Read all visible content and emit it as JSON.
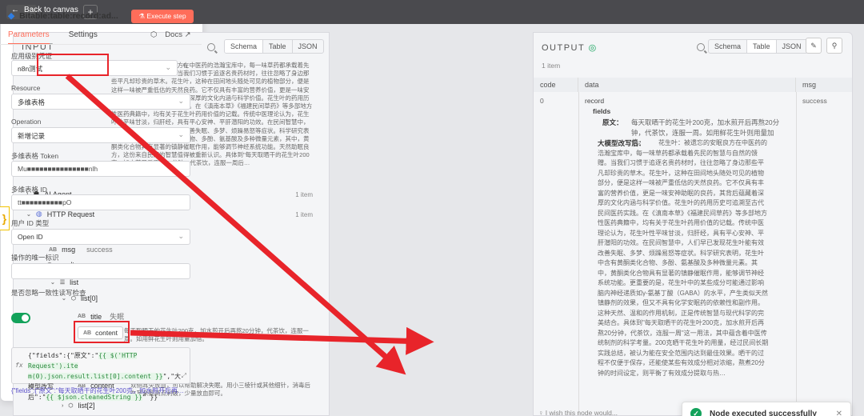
{
  "topbar": {
    "back_label": "Back to canvas"
  },
  "input": {
    "title": "INPUT",
    "view_modes": [
      "Schema",
      "Table",
      "JSON"
    ],
    "cleanedString": {
      "key": "cleanedString",
      "value": "花生叶：被遗忘的安眠良方在中医药的浩瀚宝库中，每一味草药都承载着先民的智慧与自然的馈赠。当我们习惯于追逐名贵药材时，往往忽略了身边那些平凡却珍贵的草木。花生叶，这种在田间地头随处可见的植物部分，便是这样一味被严重低估的天然良药。它不仅具有丰富的营养价值，更是一味安神助眠的良药，其背后蕴藏着深厚的文化内涵与科学价值。花生叶的药用历史可追溯至古代民间医药实践。在《滇南本草》《福建民间草药》等多部地方性医药典籍中，均有关于花生叶药用价值的记载。传统中医理论认为，花生叶性平味甘淡，归肝经，具有平心安神、平肝潜阳的功效。在民间智慧中，人们早已发现花生叶能有效改善失眠、多梦、烦躁易怒等症状。科学研究表明，花生叶中含有黄酮类化合物、多酚、氨基酸及多种微量元素，其中，黄酮类化合物具有显著的镇静催眠作用，能够调节神经系统功能。天然助眠良方，这份来自民间的智慧值得被重新认识。具体到\"每天取晒干的花生叶200克，加水煎开后再熬20分钟，代茶饮，连服一周后…"
    },
    "ai_agent": {
      "label": "AI Agent",
      "count": "1 item"
    },
    "http": {
      "label": "HTTP Request",
      "count": "1 item"
    },
    "code": {
      "key": "code",
      "value": "200"
    },
    "msg": {
      "key": "msg",
      "value": "success"
    },
    "result_key": "result",
    "list_key": "list",
    "list0": {
      "key": "list[0]",
      "title_key": "title",
      "title_val": "失眠",
      "content_key": "content",
      "content_val": "每天取晒干的花生叶200克，加水煎开后再熬20分钟，代茶饮，连服一周。如用鲜花生叶则用量加倍。"
    },
    "list1": {
      "key": "list[1]",
      "title_key": "title",
      "title_val": "失眠",
      "content_key": "content",
      "content_val": "双侧耳尖放血，可以帮助解决失眠。用小三棱针或其他细针，消毒后在耳朵最高点刺破，少量放血即可。"
    },
    "list2": {
      "key": "list[2]"
    }
  },
  "param": {
    "title": "Bitable:table:record:ad...",
    "execute_label": "Execute step",
    "tabs": [
      "Parameters",
      "Settings"
    ],
    "docs_label": "Docs",
    "credential_label": "应用级别凭证",
    "credential_value": "n8n测试",
    "resource_label": "Resource",
    "resource_value": "多维表格",
    "operation_label": "Operation",
    "operation_value": "新增记录",
    "token_label": "多维表格 Token",
    "token_value": "Mu■■■■■■■■■■■■■■■nlh",
    "table_id_label": "多维表格 ID",
    "table_id_value": "tt■■■■■■■■■■pO",
    "user_id_label": "用户 ID 类型",
    "user_id_value": "Open ID",
    "op_id_label": "操作的唯一标识",
    "ignore_label": "是否忽略一致性读写检查",
    "code_line1a": "{\"fields\":{\"原文\":\"",
    "code_line1b": "{{ $('HTTP Request').ite",
    "code_line2": "m(0).json.result.list[0].content }}",
    "code_line2b": "\",\"大模型改写",
    "code_line3a": "后\":\"",
    "code_line3b": "{{ $json.cleanedString }}",
    "code_line3c": "\" }}",
    "result_preview": "{\"fields\":{\"原文\":\"每天取晒干的花生叶200克，加水煎开后再…"
  },
  "output": {
    "title": "OUTPUT",
    "view_modes": [
      "Schema",
      "Table",
      "JSON"
    ],
    "items": "1 item",
    "columns": [
      "code",
      "data",
      "msg"
    ],
    "code_val": "0",
    "record_key": "record",
    "fields_key": "fields",
    "yuanwen_key": "原文：",
    "yuanwen_val": "每天取晒干的花生叶200克，加水煎开后再熬20分钟，代茶饮，连服一周。如用鲜花生叶则用量加倍。",
    "rewrite_key": "大模型改写后：",
    "rewrite_val": "花生叶：被遗忘的安眠良方在中医药的浩瀚宝库中，每一味草药都承载着先民的智慧与自然的馈赠。当我们习惯于追逐名贵药材时，往往忽略了身边那些平凡却珍贵的草木。花生叶，这种在田间地头随处可见的植物部分，便是这样一味被严重低估的天然良药。它不仅具有丰富的营养价值，更是一味安神助眠的良药，其背后蕴藏着深厚的文化内涵与科学价值。花生叶的药用历史可追溯至古代民间医药实践。在《滇南本草》《福建民间草药》等多部地方性医药典籍中，均有关于花生叶药用价值的记载。传统中医理论认为，花生叶性平味甘淡，归肝经，具有平心安神、平肝潜阳的功效。在民间智慧中，人们早已发现花生叶能有效改善失眠、多梦、烦躁易怒等症状。科学研究表明，花生叶中含有黄酮类化合物、多酚、氨基酸及多种微量元素。其中，黄酮类化合物具有显著的镇静催眠作用，能够调节神经系统功能。更重要的是，花生叶中的某些成分可能通过影响脑内神经递质如γ-氨基丁酸（GABA）的水平，产生类似天然镇静剂的效果，但又不具有化学安眠药的依赖性和副作用。这种天然、温和的作用机制，正是传统智慧与现代科学的完美结合。具体到\"每天取晒干的花生叶200克，加水煎开后再熬20分钟，代茶饮，连服一周\"这一用法，其中蕴含着中医传统制剂的科学考量。200克晒干花生叶的用量，经过民间长期实践总结，被认为能在安全范围内达到最佳效果。晒干的过程不仅便于保存，还能使某些有效成分相对浓缩，熬煮20分钟的时间设定，则平衡了有效成分提取与热…",
    "msg_val": "success",
    "feedback": "I wish this node would..."
  },
  "toast": {
    "text": "Node executed successfully"
  },
  "colors": {
    "accent": "#ff6d5a",
    "success": "#13a25b",
    "annotation": "#e8242a"
  }
}
